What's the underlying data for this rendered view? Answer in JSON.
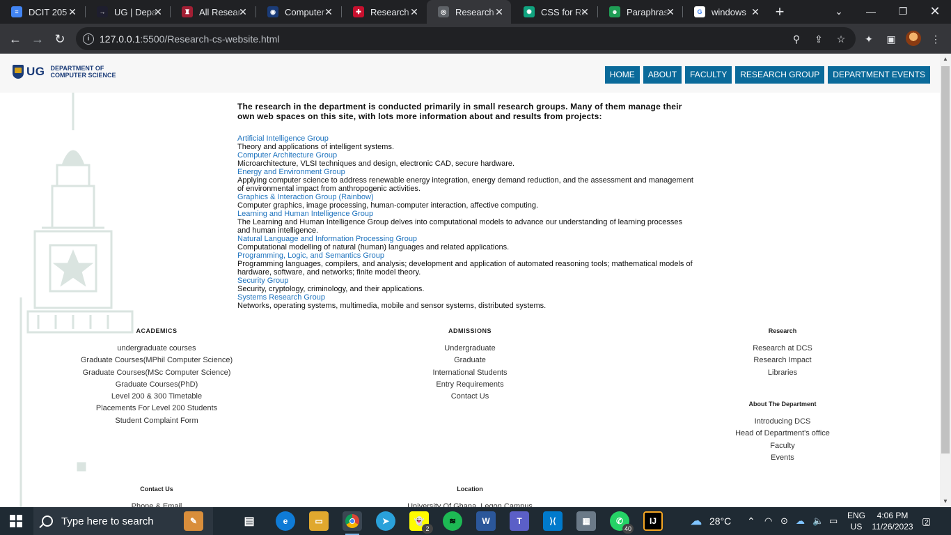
{
  "browser": {
    "tabs": [
      {
        "title": "DCIT 205",
        "favicon_color": "#4285f4",
        "favicon_glyph": "≡"
      },
      {
        "title": "UG | Depa",
        "favicon_color": "#1e1e2e",
        "favicon_glyph": "→"
      },
      {
        "title": "All Resear",
        "favicon_color": "#a31f34",
        "favicon_glyph": "♜"
      },
      {
        "title": "Computer",
        "favicon_color": "#1b3c78",
        "favicon_glyph": "◉"
      },
      {
        "title": "Research",
        "favicon_color": "#c8102e",
        "favicon_glyph": "✚"
      },
      {
        "title": "Research",
        "favicon_color": "#5f6368",
        "favicon_glyph": "◎",
        "active": true
      },
      {
        "title": "CSS for Re",
        "favicon_color": "#10a37f",
        "favicon_glyph": "✺"
      },
      {
        "title": "Paraphras",
        "favicon_color": "#1f9d55",
        "favicon_glyph": "☻"
      },
      {
        "title": "windows",
        "favicon_color": "#ffffff",
        "favicon_glyph": "G"
      }
    ],
    "url_host": "127.0.0.1",
    "url_rest": ":5500/Research-cs-website.html"
  },
  "site": {
    "logo_text": "UG",
    "dept_line1": "DEPARTMENT OF",
    "dept_line2": "COMPUTER SCIENCE",
    "nav": [
      "HOME",
      "ABOUT",
      "FACULTY",
      "RESEARCH GROUP",
      "DEPARTMENT EVENTS"
    ],
    "intro": "The research in the department is conducted primarily in small research groups. Many of them manage their own web spaces on this site, with lots more information about and results from projects:",
    "groups": [
      {
        "name": "Artificial Intelligence Group",
        "desc": "Theory and applications of intelligent systems."
      },
      {
        "name": "Computer Architecture Group",
        "desc": "Microarchitecture, VLSI techniques and design, electronic CAD, secure hardware."
      },
      {
        "name": "Energy and Environment Group",
        "desc": "Applying computer science to address renewable energy integration, energy demand reduction, and the assessment and management of environmental impact from anthropogenic activities."
      },
      {
        "name": "Graphics & Interaction Group (Rainbow)",
        "desc": "Computer graphics, image processing, human-computer interaction, affective computing."
      },
      {
        "name": "Learning and Human Intelligence Group",
        "desc": "The Learning and Human Intelligence Group delves into computational models to advance our understanding of learning processes and human intelligence."
      },
      {
        "name": "Natural Language and Information Processing Group",
        "desc": "Computational modelling of natural (human) languages and related applications."
      },
      {
        "name": "Programming, Logic, and Semantics Group",
        "desc": "Programming languages, compilers, and analysis; development and application of automated reasoning tools; mathematical models of hardware, software, and networks; finite model theory."
      },
      {
        "name": "Security Group",
        "desc": "Security, cryptology, criminology, and their applications."
      },
      {
        "name": "Systems Research Group",
        "desc": "Networks, operating systems, multimedia, mobile and sensor systems, distributed systems."
      }
    ],
    "footer": {
      "academics": {
        "heading": "ACADEMICS",
        "links": [
          "undergraduate courses",
          "Graduate Courses(MPhil Computer Science)",
          "Graduate Courses(MSc Computer Science)",
          "Graduate Courses(PhD)",
          "Level 200 & 300 Timetable",
          "Placements For Level 200 Students",
          "Student Complaint Form"
        ]
      },
      "admissions": {
        "heading": "ADMISSIONS",
        "links": [
          "Undergraduate",
          "Graduate",
          "International Students",
          "Entry Requirements",
          "Contact Us"
        ]
      },
      "research": {
        "heading": "Research",
        "links": [
          "Research at DCS",
          "Research Impact",
          "Libraries"
        ]
      },
      "about": {
        "heading": "About The Department",
        "links": [
          "Introducing DCS",
          "Head of Department's office",
          "Faculty",
          "Events"
        ]
      },
      "contact": {
        "heading": "Contact Us",
        "first_link": "Phone & Email"
      },
      "location": {
        "heading": "Location",
        "first_line": "University Of Ghana, Legon Campus"
      }
    }
  },
  "taskbar": {
    "search_placeholder": "Type here to search",
    "weather": "28°C",
    "lang_line1": "ENG",
    "lang_line2": "US",
    "time": "4:06 PM",
    "date": "11/26/2023",
    "notifications": "2",
    "snapchat_badge": "2",
    "whatsapp_badge": "40"
  }
}
